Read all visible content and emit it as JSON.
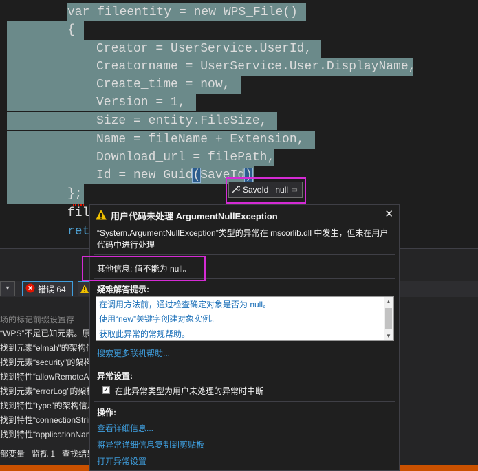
{
  "editor": {
    "lines": [
      "var fileentity = new WPS_File()",
      "{",
      "Creator = UserService.UserId,",
      "Creatorname = UserService.User.DisplayName,",
      "Create_time = now,",
      "Version = 1,",
      "Size = entity.FileSize,",
      "Name = fileName + Extension,",
      "Download_url = filePath,",
      "Id = new Guid",
      "(",
      "SaveId",
      ")",
      "};",
      "fil",
      "ret"
    ],
    "datatip": {
      "name": "SaveId",
      "value": "null"
    }
  },
  "errorlist": {
    "error_button": "错误 64",
    "rows": [
      "“WPS”不是已知元素。原",
      "找到元素“elmah”的架构信",
      "找到元素“security”的架构",
      "找到特性“allowRemoteAc",
      "找到元素“errorLog”的架构",
      "找到特性“type”的架构信息",
      "找到特性“connectionStrin",
      "找到特性“applicationNam"
    ],
    "tabs": [
      "部变量",
      "监视 1",
      "查找结果"
    ]
  },
  "exception": {
    "title": "用户代码未处理 ArgumentNullException",
    "message": "“System.ArgumentNullException”类型的异常在 mscorlib.dll 中发生，但未在用户代码中进行处理",
    "extra": "其他信息: 值不能为 null。",
    "tips_title": "疑难解答提示:",
    "tips": [
      "在调用方法前，通过检查确定对象是否为 null。",
      "使用“new”关键字创建对象实例。",
      "获取此异常的常规帮助。"
    ],
    "search_more": "搜索更多联机帮助...",
    "settings_title": "异常设置:",
    "settings_checkbox": "在此异常类型为用户未处理的异常时中断",
    "actions_title": "操作:",
    "actions": [
      "查看详细信息...",
      "将异常详细信息复制到剪贴板",
      "打开异常设置"
    ]
  },
  "colors": {
    "highlight": "#d42bd4",
    "selection": "#6b8a8a",
    "link": "#3f9fdf",
    "statusbar": "#ca5100"
  }
}
